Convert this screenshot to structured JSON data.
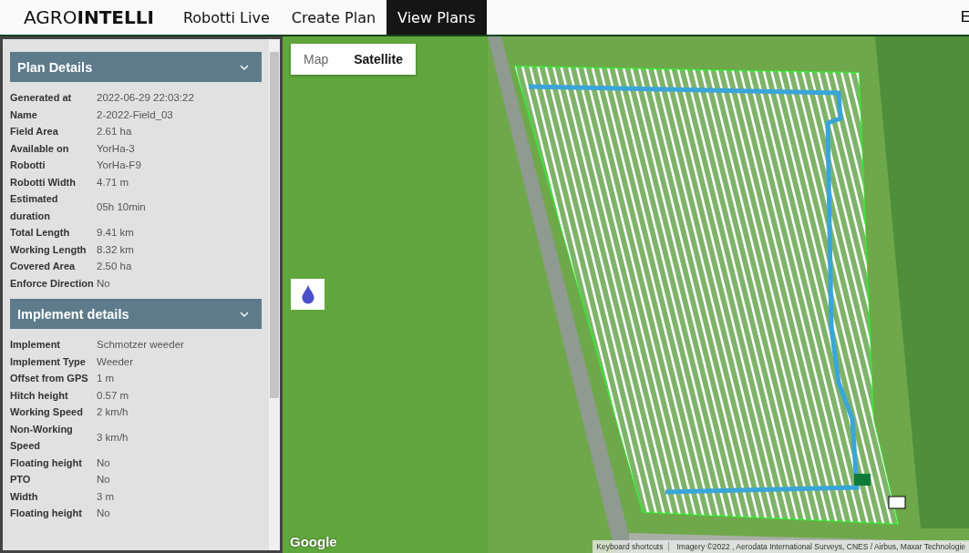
{
  "brand": "AGRO**INTELLI**",
  "nav": [
    {
      "label": "Robotti Live",
      "selected": false
    },
    {
      "label": "Create Plan",
      "selected": false
    },
    {
      "label": "View Plans",
      "selected": true
    }
  ],
  "nav_edge": "E",
  "sections": [
    {
      "title": "Plan Details",
      "rows": [
        {
          "label": "Generated at",
          "value": "2022-06-29 22:03:22"
        },
        {
          "label": "Name",
          "value": "2-2022-Field_03"
        },
        {
          "label": "Field Area",
          "value": "2.61 ha"
        },
        {
          "label": "Available on",
          "value": "YorHa-3"
        },
        {
          "label": "Robotti",
          "value": "YorHa-F9"
        },
        {
          "label": "Robotti Width",
          "value": "4.71 m"
        },
        {
          "label": "Estimated duration",
          "value": "05h 10min"
        },
        {
          "label": "Total Length",
          "value": "9.41 km"
        },
        {
          "label": "Working Length",
          "value": "8.32 km"
        },
        {
          "label": "Covered Area",
          "value": "2.50 ha"
        },
        {
          "label": "Enforce Direction",
          "value": "No"
        }
      ]
    },
    {
      "title": "Implement details",
      "rows": [
        {
          "label": "Implement",
          "value": "Schmotzer weeder"
        },
        {
          "label": "Implement Type",
          "value": "Weeder"
        },
        {
          "label": "Offset from GPS",
          "value": "1 m"
        },
        {
          "label": "Hitch height",
          "value": "0.57 m"
        },
        {
          "label": "Working Speed",
          "value": "2 km/h"
        },
        {
          "label": "Non-Working Speed",
          "value": "3 km/h"
        },
        {
          "label": "Floating height",
          "value": "No"
        },
        {
          "label": "PTO",
          "value": "No"
        },
        {
          "label": "Width",
          "value": "3 m"
        },
        {
          "label": "Floating height",
          "value": "No"
        }
      ]
    }
  ],
  "map_types": [
    {
      "label": "Map",
      "selected": false
    },
    {
      "label": "Satellite",
      "selected": true
    }
  ],
  "google": "Google",
  "attribution": [
    "Keyboard shortcuts",
    "Imagery ©2022 , Aerodata International Surveys, CNES / Airbus, Maxar Technologie"
  ]
}
